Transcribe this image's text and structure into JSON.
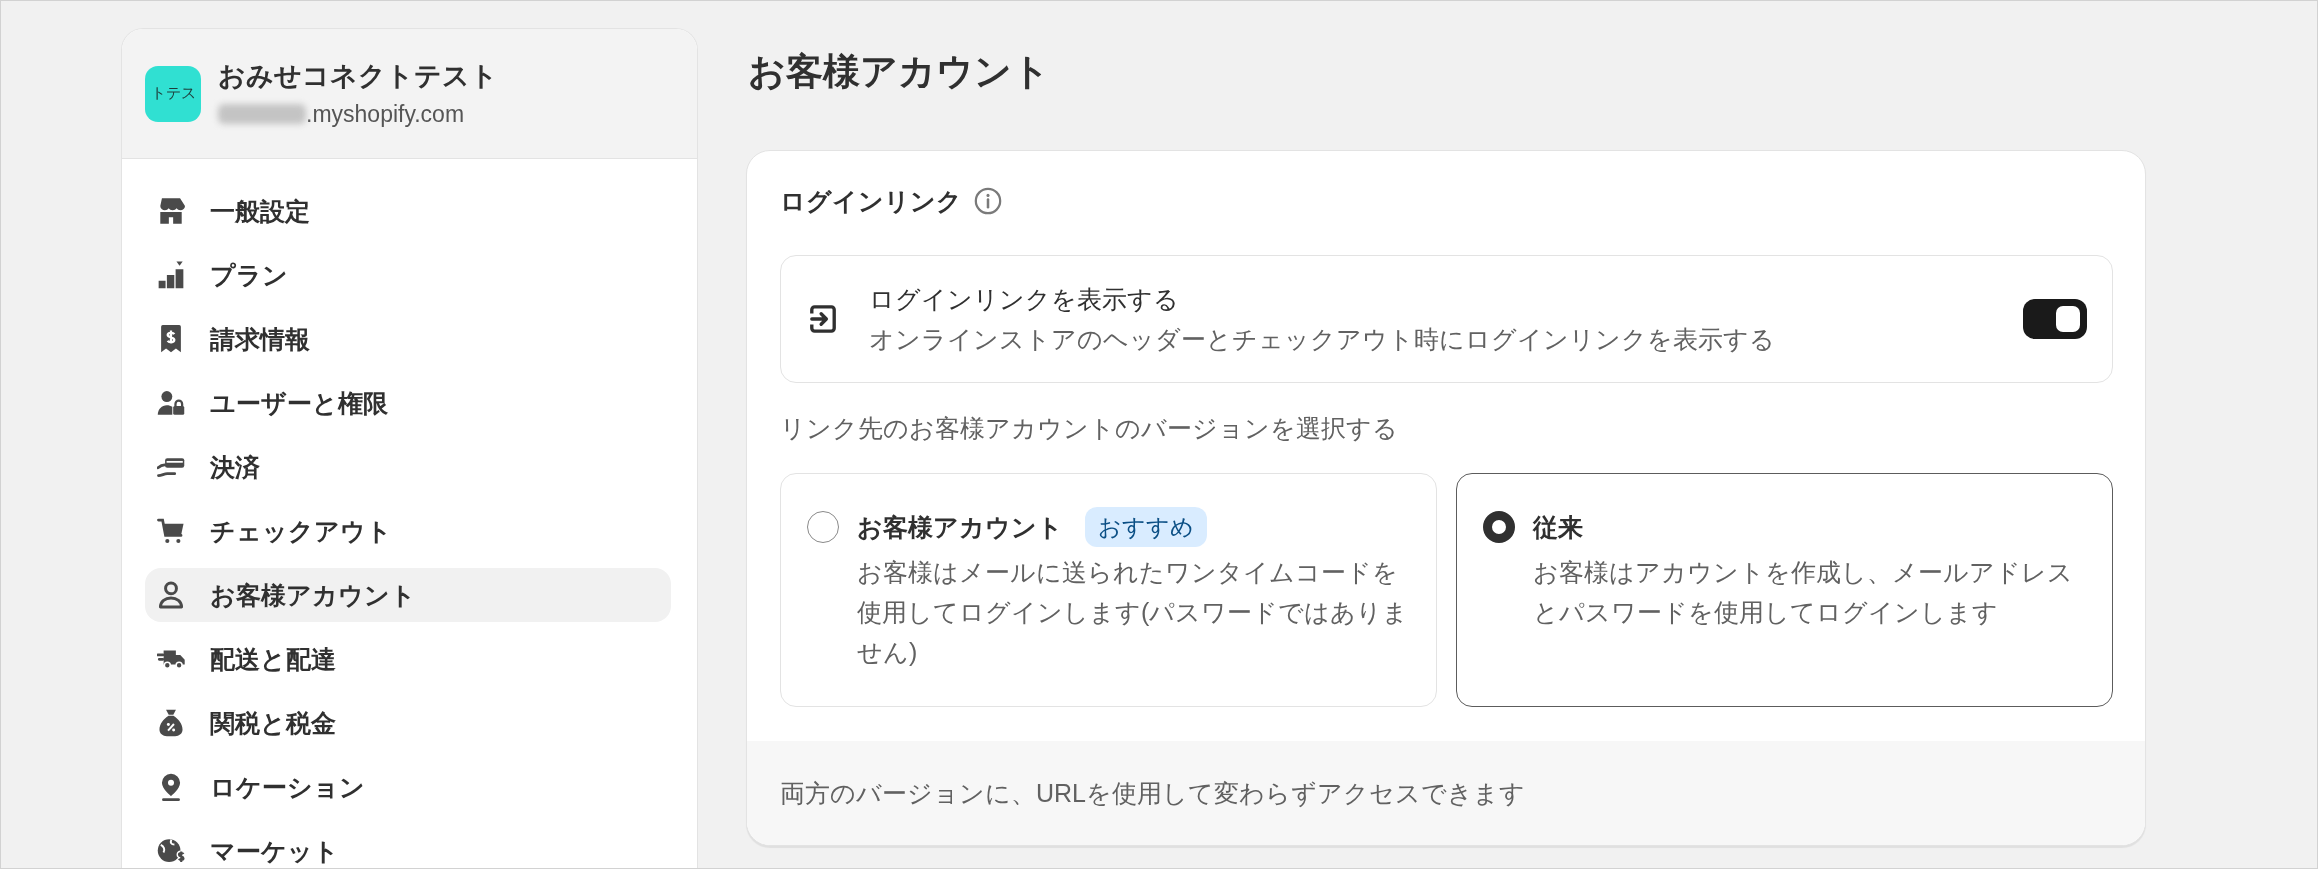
{
  "sidebar": {
    "store": {
      "avatar_text": "トテス",
      "name": "おみせコネクトテスト",
      "domain": ".myshopify.com"
    },
    "items": [
      {
        "label": "一般設定",
        "selected": false
      },
      {
        "label": "プラン",
        "selected": false
      },
      {
        "label": "請求情報",
        "selected": false
      },
      {
        "label": "ユーザーと権限",
        "selected": false
      },
      {
        "label": "決済",
        "selected": false
      },
      {
        "label": "チェックアウト",
        "selected": false
      },
      {
        "label": "お客様アカウント",
        "selected": true
      },
      {
        "label": "配送と配達",
        "selected": false
      },
      {
        "label": "関税と税金",
        "selected": false
      },
      {
        "label": "ロケーション",
        "selected": false
      },
      {
        "label": "マーケット",
        "selected": false
      }
    ]
  },
  "page": {
    "title": "お客様アカウント"
  },
  "login_link": {
    "heading": "ログインリンク",
    "toggle": {
      "title": "ログインリンクを表示する",
      "description": "オンラインストアのヘッダーとチェックアウト時にログインリンクを表示する",
      "on": true
    },
    "version_prompt": "リンク先のお客様アカウントのバージョンを選択する",
    "options": [
      {
        "title": "お客様アカウント",
        "badge": "おすすめ",
        "description": "お客様はメールに送られたワンタイムコードを使用してログインします(パスワードではありません)",
        "selected": false
      },
      {
        "title": "従来",
        "description": "お客様はアカウントを作成し、メールアドレスとパスワードを使用してログインします",
        "selected": true
      }
    ],
    "footer": "両方のバージョンに、URLを使用して変わらずアクセスできます"
  }
}
